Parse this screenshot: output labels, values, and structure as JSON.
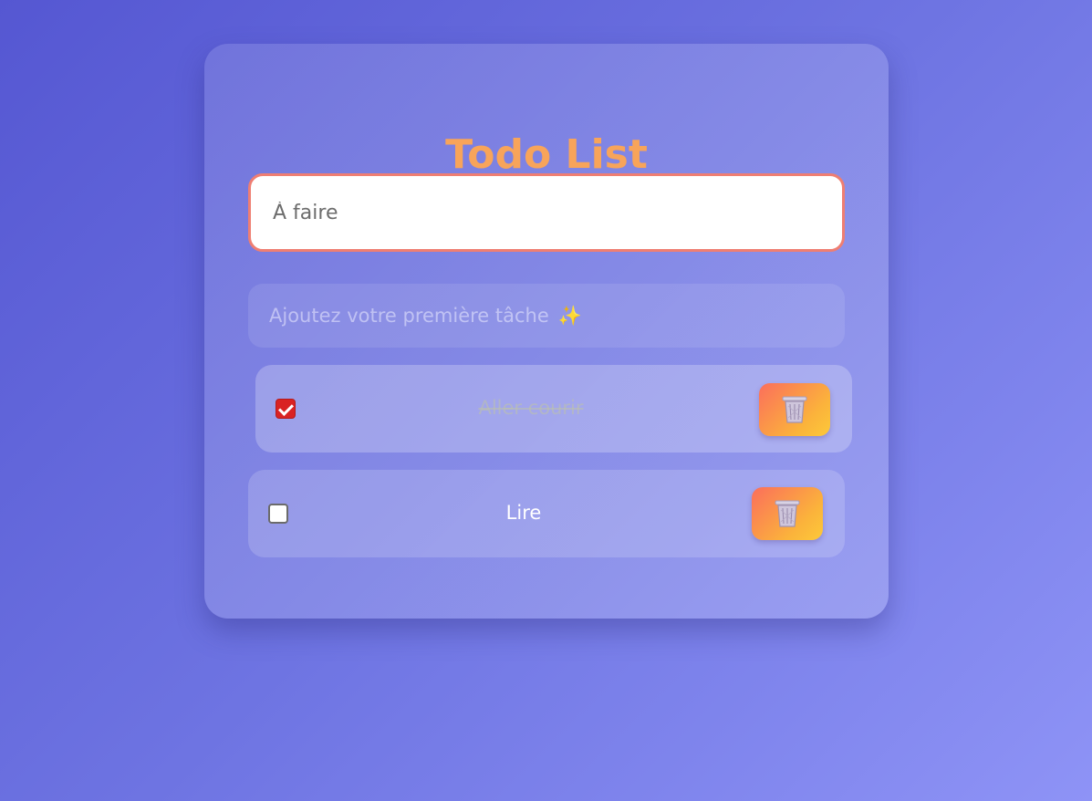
{
  "app": {
    "title": "Todo List"
  },
  "input": {
    "placeholder": "À faire",
    "value": ""
  },
  "hint": {
    "text": "Ajoutez votre première tâche",
    "emoji": "✨"
  },
  "todos": [
    {
      "text": "Aller courir",
      "done": true,
      "delete_icon": "trash-icon"
    },
    {
      "text": "Lire",
      "done": false,
      "delete_icon": "trash-icon"
    }
  ],
  "colors": {
    "title": "#f8a45a",
    "input_border": "#ef7e72",
    "checkbox_checked": "#d92323",
    "delete_gradient_start": "#fb6e5c",
    "delete_gradient_end": "#fcc93a"
  }
}
